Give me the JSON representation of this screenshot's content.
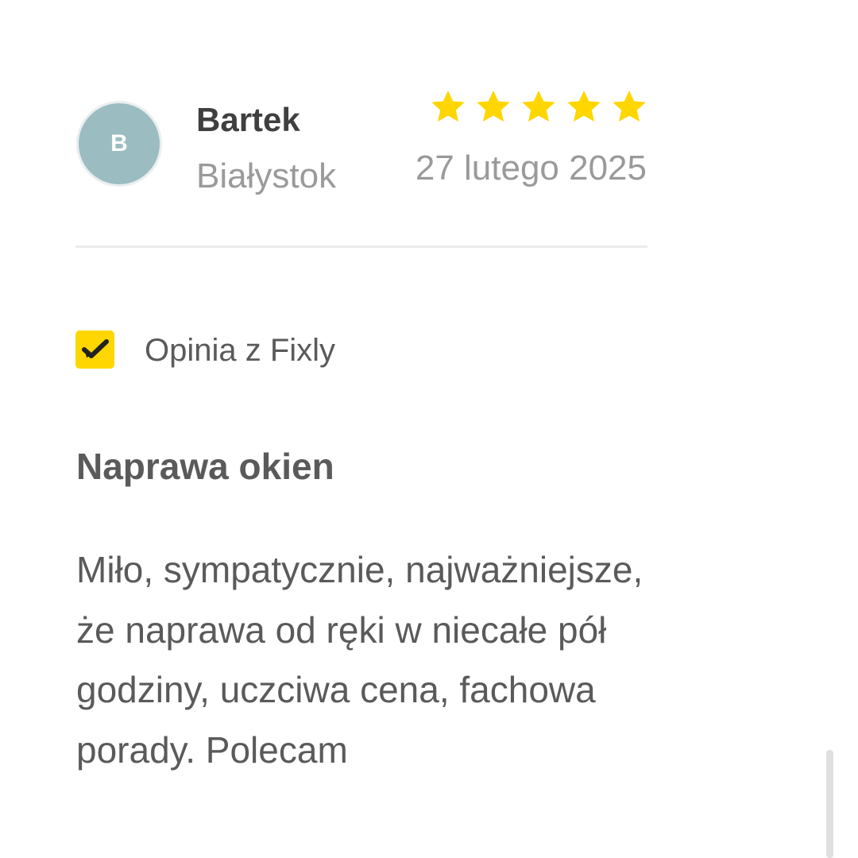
{
  "review": {
    "avatar_initial": "B",
    "user_name": "Bartek",
    "city": "Białystok",
    "rating": 5,
    "rating_max": 5,
    "date": "27 lutego 2025",
    "verified_label": "Opinia z Fixly",
    "title": "Naprawa okien",
    "body": "Miło, sympatycznie, najważniejsze, że naprawa od ręki w niecałe pół godziny, uczciwa cena, fachowa porady. Polecam"
  },
  "colors": {
    "star": "#ffd600",
    "verified_badge": "#ffd600",
    "avatar_bg": "#9bbdc1",
    "text_dark": "#3f3f3f",
    "text_muted": "#9a9a9a",
    "text_body": "#5a5a5a"
  },
  "icons": {
    "star": "star-icon",
    "verified": "checkmark-icon"
  }
}
